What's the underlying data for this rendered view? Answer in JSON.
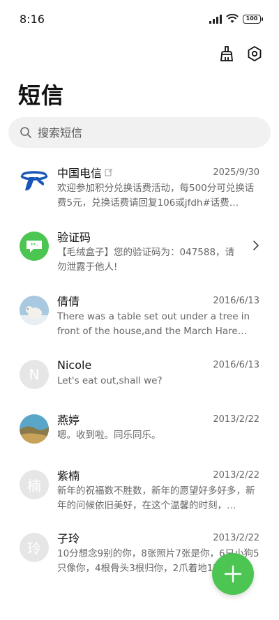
{
  "status": {
    "time": "8:16",
    "battery": "100"
  },
  "header": {
    "title": "短信",
    "clean_icon": "broom-icon",
    "settings_icon": "settings-hexagon-icon"
  },
  "search": {
    "placeholder": "搜索短信"
  },
  "messages": [
    {
      "name": "中国电信",
      "date": "2025/9/30",
      "preview": "欢迎参加积分兑换话费活动，每500分可兑换话费5元，兑换话费请回复106或jfdh#话费…",
      "avatar": "china-telecom-logo",
      "verified": true
    },
    {
      "name": "验证码",
      "date": "",
      "preview": "【毛绒盒子】您的验证码为：047588，请勿泄露于他人!",
      "avatar": "verification-code-icon",
      "color": "#4cc552"
    },
    {
      "name": "倩倩",
      "date": "2016/6/13",
      "preview": "There was a table set out under a tree in front of the house,and the March Hare an…",
      "avatar": "polar-bear-photo"
    },
    {
      "name": "Nicole",
      "date": "2016/6/13",
      "preview": "Let's eat out,shall we?",
      "avatar_letter": "N"
    },
    {
      "name": "燕婷",
      "date": "2013/2/22",
      "preview": "嗯。收到啦。同乐同乐。",
      "avatar": "landscape-photo"
    },
    {
      "name": "紫楠",
      "date": "2013/2/22",
      "preview": "新年的祝福数不胜数，新年的愿望好多好多，新年的问候依旧美好，在这个温馨的时刻，…",
      "avatar_letter": "楠"
    },
    {
      "name": "子玲",
      "date": "2013/2/22",
      "preview": "10分想念9别的你，8张照片7张是你，6只小狗5只像你，4根骨头3根归你，2爪着地1定…",
      "avatar_letter": "玲"
    }
  ],
  "fab": {
    "icon": "plus-icon",
    "color": "#4cc552"
  }
}
